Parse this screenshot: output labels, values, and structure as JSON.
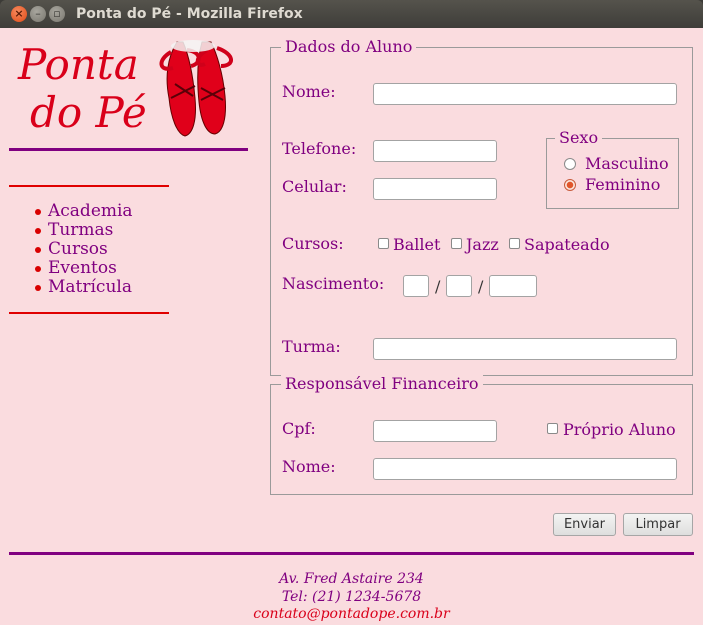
{
  "window": {
    "title": "Ponta do Pé - Mozilla Firefox"
  },
  "logo": {
    "line1": "Ponta",
    "line2": "do Pé"
  },
  "menu": [
    "Academia",
    "Turmas",
    "Cursos",
    "Eventos",
    "Matrícula"
  ],
  "aluno": {
    "legend": "Dados do Aluno",
    "nome_label": "Nome:",
    "telefone_label": "Telefone:",
    "celular_label": "Celular:",
    "sexo": {
      "legend": "Sexo",
      "options": [
        "Masculino",
        "Feminino"
      ],
      "selected": "Feminino"
    },
    "cursos_label": "Cursos:",
    "cursos": [
      "Ballet",
      "Jazz",
      "Sapateado"
    ],
    "nascimento_label": "Nascimento:",
    "date_separator": "/",
    "turma_label": "Turma:"
  },
  "responsavel": {
    "legend": "Responsável Financeiro",
    "cpf_label": "Cpf:",
    "proprio_aluno": "Próprio Aluno",
    "nome_label": "Nome:"
  },
  "buttons": {
    "enviar": "Enviar",
    "limpar": "Limpar"
  },
  "footer": {
    "address": "Av. Fred Astaire 234",
    "tel": "Tel: (21) 1234-5678",
    "email": "contato@pontadope.com.br"
  },
  "colors": {
    "accent": "#800080",
    "brand_red": "#d9001a",
    "background": "#fadcdf"
  }
}
